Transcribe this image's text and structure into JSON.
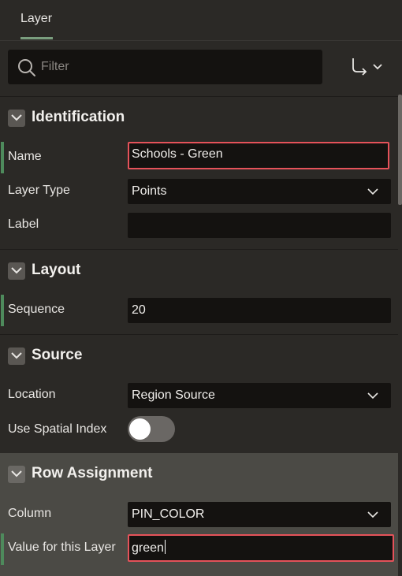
{
  "tabs": [
    {
      "label": "Layer",
      "active": true
    }
  ],
  "filter": {
    "placeholder": "Filter",
    "value": ""
  },
  "goto_button": {
    "icon": "goto-arrow-icon",
    "dropdown_icon": "chevron-down-icon"
  },
  "sections": {
    "identification": {
      "title": "Identification",
      "name": {
        "label": "Name",
        "value": "Schools - Green",
        "required": true,
        "error": true
      },
      "layer_type": {
        "label": "Layer Type",
        "value": "Points"
      },
      "label": {
        "label": "Label",
        "value": ""
      }
    },
    "layout": {
      "title": "Layout",
      "sequence": {
        "label": "Sequence",
        "value": "20",
        "required": true
      }
    },
    "source": {
      "title": "Source",
      "location": {
        "label": "Location",
        "value": "Region Source"
      },
      "spatial_index": {
        "label": "Use Spatial Index",
        "value": false
      }
    },
    "row_assignment": {
      "title": "Row Assignment",
      "column": {
        "label": "Column",
        "value": "PIN_COLOR"
      },
      "value_for_layer": {
        "label": "Value for this Layer",
        "value": "green",
        "required": true,
        "error": true
      }
    }
  },
  "colors": {
    "background": "#2b2926",
    "field": "#141210",
    "error_border": "#e5525a",
    "required_bar": "#4e8a5c",
    "active_section": "#4b4a45"
  }
}
